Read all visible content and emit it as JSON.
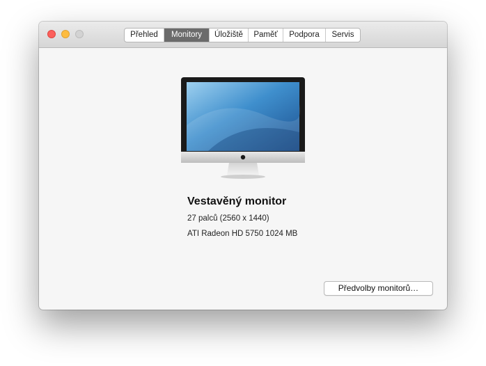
{
  "window": {
    "tabs": [
      {
        "label": "Přehled",
        "active": false
      },
      {
        "label": "Monitory",
        "active": true
      },
      {
        "label": "Úložiště",
        "active": false
      },
      {
        "label": "Paměť",
        "active": false
      },
      {
        "label": "Podpora",
        "active": false
      },
      {
        "label": "Servis",
        "active": false
      }
    ]
  },
  "display": {
    "name": "Vestavěný monitor",
    "size": "27 palců (2560 x 1440)",
    "gpu": "ATI Radeon HD 5750 1024 MB",
    "icon": "imac-icon"
  },
  "actions": {
    "preferences_label": "Předvolby monitorů…"
  },
  "colors": {
    "close": "#fc605c",
    "minimize": "#fdbc40",
    "zoom": "#d3d3d3",
    "active_tab": "#6b6b6b"
  }
}
